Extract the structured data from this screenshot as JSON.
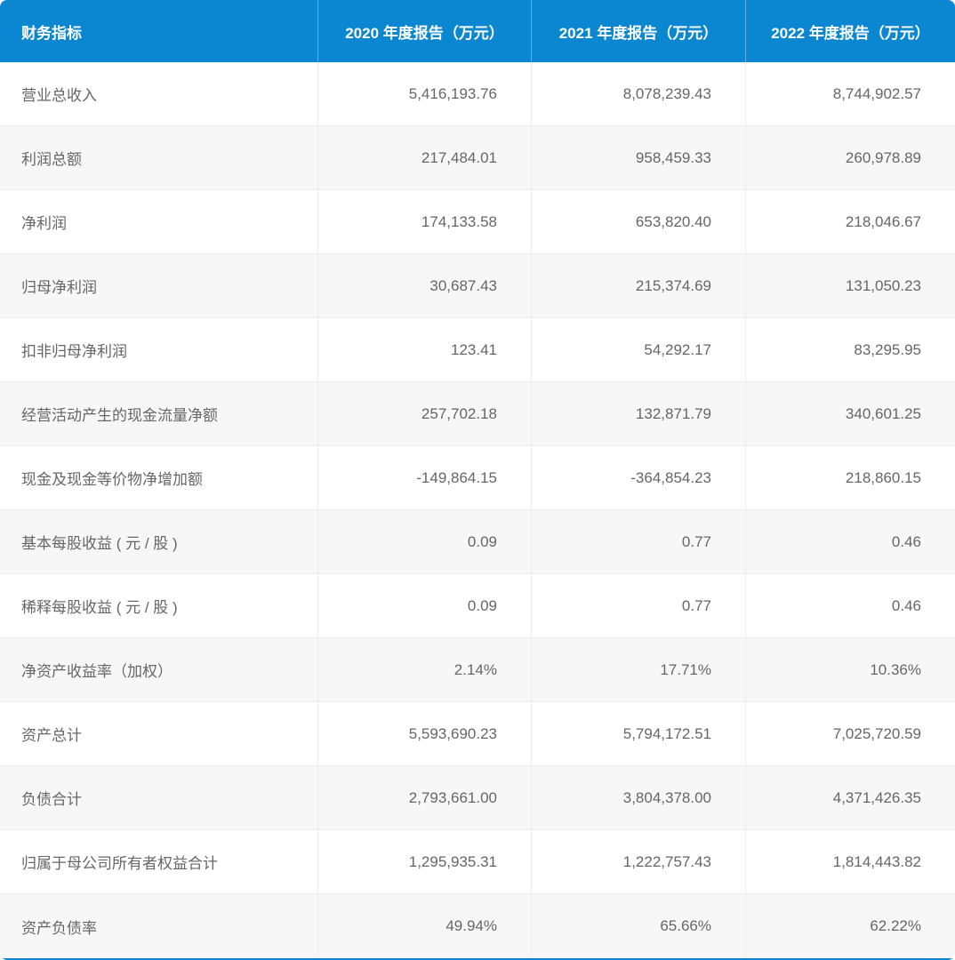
{
  "table": {
    "indicator_header": "财务指标",
    "columns": [
      "2020 年度报告（万元）",
      "2021 年度报告（万元）",
      "2022 年度报告（万元）"
    ],
    "rows": [
      {
        "label": "营业总收入",
        "values": [
          "5,416,193.76",
          "8,078,239.43",
          "8,744,902.57"
        ]
      },
      {
        "label": "利润总额",
        "values": [
          "217,484.01",
          "958,459.33",
          "260,978.89"
        ]
      },
      {
        "label": "净利润",
        "values": [
          "174,133.58",
          "653,820.40",
          "218,046.67"
        ]
      },
      {
        "label": "归母净利润",
        "values": [
          "30,687.43",
          "215,374.69",
          "131,050.23"
        ]
      },
      {
        "label": "扣非归母净利润",
        "values": [
          "123.41",
          "54,292.17",
          "83,295.95"
        ]
      },
      {
        "label": "经营活动产生的现金流量净额",
        "values": [
          "257,702.18",
          "132,871.79",
          "340,601.25"
        ]
      },
      {
        "label": "现金及现金等价物净增加额",
        "values": [
          "-149,864.15",
          "-364,854.23",
          "218,860.15"
        ]
      },
      {
        "label": "基本每股收益 ( 元 / 股 )",
        "values": [
          "0.09",
          "0.77",
          "0.46"
        ]
      },
      {
        "label": "稀释每股收益 ( 元 / 股 )",
        "values": [
          "0.09",
          "0.77",
          "0.46"
        ]
      },
      {
        "label": "净资产收益率（加权）",
        "values": [
          "2.14%",
          "17.71%",
          "10.36%"
        ]
      },
      {
        "label": "资产总计",
        "values": [
          "5,593,690.23",
          "5,794,172.51",
          "7,025,720.59"
        ]
      },
      {
        "label": "负债合计",
        "values": [
          "2,793,661.00",
          "3,804,378.00",
          "4,371,426.35"
        ]
      },
      {
        "label": "归属于母公司所有者权益合计",
        "values": [
          "1,295,935.31",
          "1,222,757.43",
          "1,814,443.82"
        ]
      },
      {
        "label": "资产负债率",
        "values": [
          "49.94%",
          "65.66%",
          "62.22%"
        ]
      }
    ]
  },
  "colors": {
    "header_bg": "#0b86d1",
    "header_text": "#ffffff",
    "row_bg": "#ffffff",
    "row_alt_bg": "#f7f7f8",
    "border": "#ededed",
    "text": "#666666",
    "bottom_accent": "#0b86d1"
  },
  "chart_data": {
    "type": "table",
    "title": "财务指标年度报告对比表",
    "columns": [
      "财务指标",
      "2020 年度报告（万元）",
      "2021 年度报告（万元）",
      "2022 年度报告（万元）"
    ],
    "rows": [
      [
        "营业总收入",
        5416193.76,
        8078239.43,
        8744902.57
      ],
      [
        "利润总额",
        217484.01,
        958459.33,
        260978.89
      ],
      [
        "净利润",
        174133.58,
        653820.4,
        218046.67
      ],
      [
        "归母净利润",
        30687.43,
        215374.69,
        131050.23
      ],
      [
        "扣非归母净利润",
        123.41,
        54292.17,
        83295.95
      ],
      [
        "经营活动产生的现金流量净额",
        257702.18,
        132871.79,
        340601.25
      ],
      [
        "现金及现金等价物净增加额",
        -149864.15,
        -364854.23,
        218860.15
      ],
      [
        "基本每股收益 ( 元 / 股 )",
        0.09,
        0.77,
        0.46
      ],
      [
        "稀释每股收益 ( 元 / 股 )",
        0.09,
        0.77,
        0.46
      ],
      [
        "净资产收益率（加权）",
        "2.14%",
        "17.71%",
        "10.36%"
      ],
      [
        "资产总计",
        5593690.23,
        5794172.51,
        7025720.59
      ],
      [
        "负债合计",
        2793661.0,
        3804378.0,
        4371426.35
      ],
      [
        "归属于母公司所有者权益合计",
        1295935.31,
        1222757.43,
        1814443.82
      ],
      [
        "资产负债率",
        "49.94%",
        "65.66%",
        "62.22%"
      ]
    ]
  }
}
